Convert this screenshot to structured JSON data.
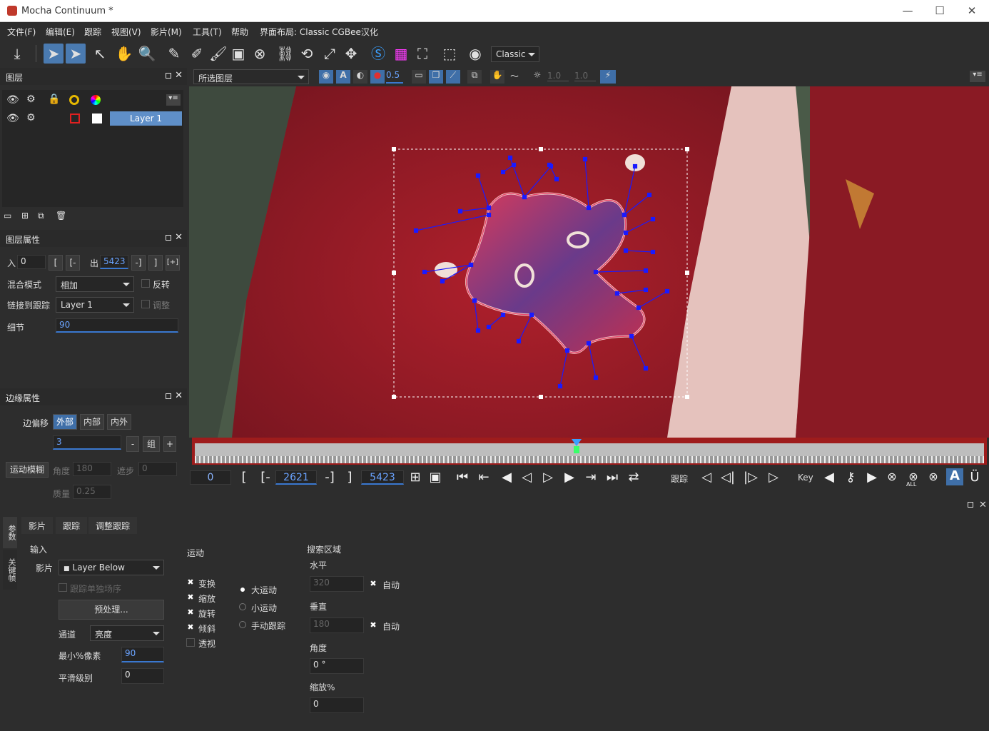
{
  "window": {
    "title": "Mocha Continuum *",
    "minimize": "—",
    "maximize": "☐",
    "close": "✕"
  },
  "menu": [
    "文件(F)",
    "编辑(E)",
    "跟踪",
    "视图(V)",
    "影片(M)",
    "工具(T)",
    "帮助",
    "界面布局: Classic CGBee汉化"
  ],
  "toolbar": {
    "workspace_label": "Classic"
  },
  "viewer_bar": {
    "layer_select": "所选图层",
    "opacity": "0.5",
    "val1": "1.0",
    "val2": "1.0"
  },
  "layers_panel": {
    "title": "图层",
    "layer_name": "Layer 1"
  },
  "layer_props": {
    "title": "图层属性",
    "in_label": "入",
    "in_value": "0",
    "out_label": "出",
    "out_value": "5423",
    "bracket1": "[",
    "bracket2": "[-",
    "bracket3": "-]",
    "bracket4": "]",
    "bracket5": "[+]",
    "blend_label": "混合模式",
    "blend_value": "相加",
    "invert_label": "反转",
    "link_label": "链接到跟踪",
    "link_value": "Layer 1",
    "adjust_label": "调整",
    "detail_label": "细节",
    "detail_value": "90"
  },
  "edge_props": {
    "title": "边缘属性",
    "offset_label": "边偏移",
    "btn_outer": "外部",
    "btn_inner": "内部",
    "btn_inout": "内外",
    "offset_value": "3",
    "minus": "-",
    "group": "组",
    "plus": "+",
    "motion_blur": "运动模糊",
    "angle_label": "角度",
    "angle_value": "180",
    "phase_label": "遮步",
    "phase_value": "0",
    "quality_label": "质量",
    "quality_value": "0.25"
  },
  "transport": {
    "current_frame": "0",
    "in_point": "2621",
    "out_point": "5423",
    "b_open": "[",
    "b_open_dash": "[-",
    "b_close_dash": "-]",
    "b_close": "]",
    "track_label": "跟踪",
    "key_label": "Key",
    "all_label": "ALL"
  },
  "bottom_tabs": {
    "side_params": "参数",
    "side_keys": "关键帧",
    "clip": "影片",
    "track": "跟踪",
    "adjust": "调整跟踪"
  },
  "input": {
    "title": "输入",
    "clip_label": "影片",
    "clip_value": "Layer Below",
    "track_individual": "跟踪单独场序",
    "preprocess": "预处理...",
    "channel_label": "通道",
    "channel_value": "亮度",
    "min_pixels_label": "最小%像素",
    "min_pixels_value": "90",
    "smooth_label": "平滑级别",
    "smooth_value": "0"
  },
  "motion": {
    "title": "运动",
    "translate": "变换",
    "scale": "缩放",
    "rotate": "旋转",
    "shear": "倾斜",
    "perspective": "透视",
    "large": "大运动",
    "small": "小运动",
    "manual": "手动跟踪"
  },
  "search": {
    "title": "搜索区域",
    "horizontal_label": "水平",
    "horizontal_value": "320",
    "auto1": "自动",
    "vertical_label": "垂直",
    "vertical_value": "180",
    "auto2": "自动",
    "angle_label": "角度",
    "angle_value": "0 °",
    "zoom_label": "缩放%",
    "zoom_value": "0"
  },
  "colors": {
    "accent": "#3f6fa8",
    "timeline": "#9e1c1c",
    "spline": "#1a1aff"
  }
}
